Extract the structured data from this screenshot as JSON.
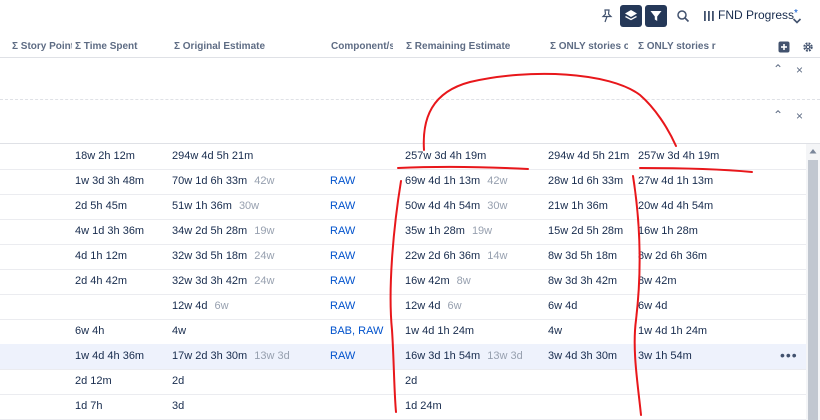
{
  "toolbar": {
    "title": "FND Progress",
    "unsaved_mark": "*",
    "icons": [
      "pin-icon",
      "layers-icon",
      "filter-icon",
      "search-icon",
      "columns-icon",
      "chevron-down-icon"
    ]
  },
  "columns": [
    "Σ Story Points",
    "Σ Time Spent",
    "Σ Original Estimate",
    "Component/s",
    "Σ Remaining Estimate",
    "Σ ONLY stories original",
    "Σ ONLY stories remaining"
  ],
  "rows": [
    {
      "time_spent": "18w 2h 12m",
      "orig": "294w 4d 5h 21m",
      "orig_sub": "",
      "component": "",
      "remaining": "257w 3d 4h 19m",
      "rem_sub": "",
      "only_orig": "294w 4d 5h 21m",
      "only_rem": "257w 3d 4h 19m"
    },
    {
      "time_spent": "1w 3d 3h 48m",
      "orig": "70w 1d 6h 33m",
      "orig_sub": "42w",
      "component": "RAW",
      "remaining": "69w 4d 1h 13m",
      "rem_sub": "42w",
      "only_orig": "28w 1d 6h 33m",
      "only_rem": "27w 4d 1h 13m"
    },
    {
      "time_spent": "2d 5h 45m",
      "orig": "51w 1h 36m",
      "orig_sub": "30w",
      "component": "RAW",
      "remaining": "50w 4d 4h 54m",
      "rem_sub": "30w",
      "only_orig": "21w 1h 36m",
      "only_rem": "20w 4d 4h 54m"
    },
    {
      "time_spent": "4w 1d 3h 36m",
      "orig": "34w 2d 5h 28m",
      "orig_sub": "19w",
      "component": "RAW",
      "remaining": "35w 1h 28m",
      "rem_sub": "19w",
      "only_orig": "15w 2d 5h 28m",
      "only_rem": "16w 1h 28m"
    },
    {
      "time_spent": "4d 1h 12m",
      "orig": "32w 3d 5h 18m",
      "orig_sub": "24w",
      "component": "RAW",
      "remaining": "22w 2d 6h 36m",
      "rem_sub": "14w",
      "only_orig": "8w 3d 5h 18m",
      "only_rem": "8w 2d 6h 36m"
    },
    {
      "time_spent": "2d 4h 42m",
      "orig": "32w 3d 3h 42m",
      "orig_sub": "24w",
      "component": "RAW",
      "remaining": "16w 42m",
      "rem_sub": "8w",
      "only_orig": "8w 3d 3h 42m",
      "only_rem": "8w 42m"
    },
    {
      "time_spent": "",
      "orig": "12w 4d",
      "orig_sub": "6w",
      "component": "RAW",
      "remaining": "12w 4d",
      "rem_sub": "6w",
      "only_orig": "6w 4d",
      "only_rem": "6w 4d"
    },
    {
      "time_spent": "6w 4h",
      "orig": "4w",
      "orig_sub": "",
      "component": "BAB, RAW",
      "remaining": "1w 4d 1h 24m",
      "rem_sub": "",
      "only_orig": "4w",
      "only_rem": "1w 4d 1h 24m"
    },
    {
      "time_spent": "1w 4d 4h 36m",
      "orig": "17w 2d 3h 30m",
      "orig_sub": "13w 3d",
      "component": "RAW",
      "remaining": "16w 3d 1h 54m",
      "rem_sub": "13w 3d",
      "only_orig": "3w 4d 3h 30m",
      "only_rem": "3w 1h 54m"
    },
    {
      "time_spent": "2d 12m",
      "orig": "2d",
      "orig_sub": "",
      "component": "",
      "remaining": "2d",
      "rem_sub": "",
      "only_orig": "",
      "only_rem": ""
    },
    {
      "time_spent": "1d 7h",
      "orig": "3d",
      "orig_sub": "",
      "component": "",
      "remaining": "1d 24m",
      "rem_sub": "",
      "only_orig": "",
      "only_rem": ""
    }
  ],
  "row_menu": "•••",
  "group_controls": {
    "collapse": "⌃",
    "close": "×"
  },
  "colors": {
    "accent": "#0052cc",
    "annotation": "#e8171b",
    "highlight_row": "#eef2fc"
  }
}
